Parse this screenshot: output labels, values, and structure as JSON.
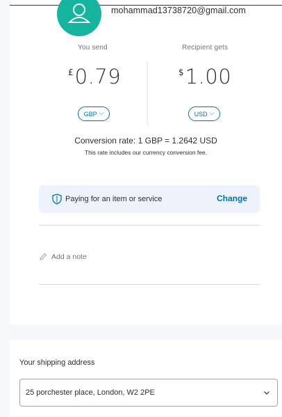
{
  "recipient": {
    "email": "mohammad13738720@gmail.com",
    "avatar_icon": "person-icon"
  },
  "send": {
    "label": "You send",
    "symbol": "£",
    "amount": "0.79",
    "currency": "GBP"
  },
  "receive": {
    "label": "Recipient gets",
    "symbol": "$",
    "amount": "1.00",
    "currency": "USD"
  },
  "conversion": {
    "rate_text": "Conversion rate: 1 GBP = 1.2642 USD",
    "fee_note": "This rate includes our currency conversion fee."
  },
  "purpose": {
    "icon": "shield-icon",
    "text": "Paying for an item or service",
    "change_label": "Change"
  },
  "note": {
    "icon": "pencil-icon",
    "placeholder": "Add a note"
  },
  "shipping": {
    "label": "Your shipping address",
    "address": "25 porchester place, London, W2 2PE"
  },
  "colors": {
    "brand_blue": "#0070ba",
    "avatar_teal": "#14b49f",
    "purpose_bg": "#eef3fb"
  }
}
